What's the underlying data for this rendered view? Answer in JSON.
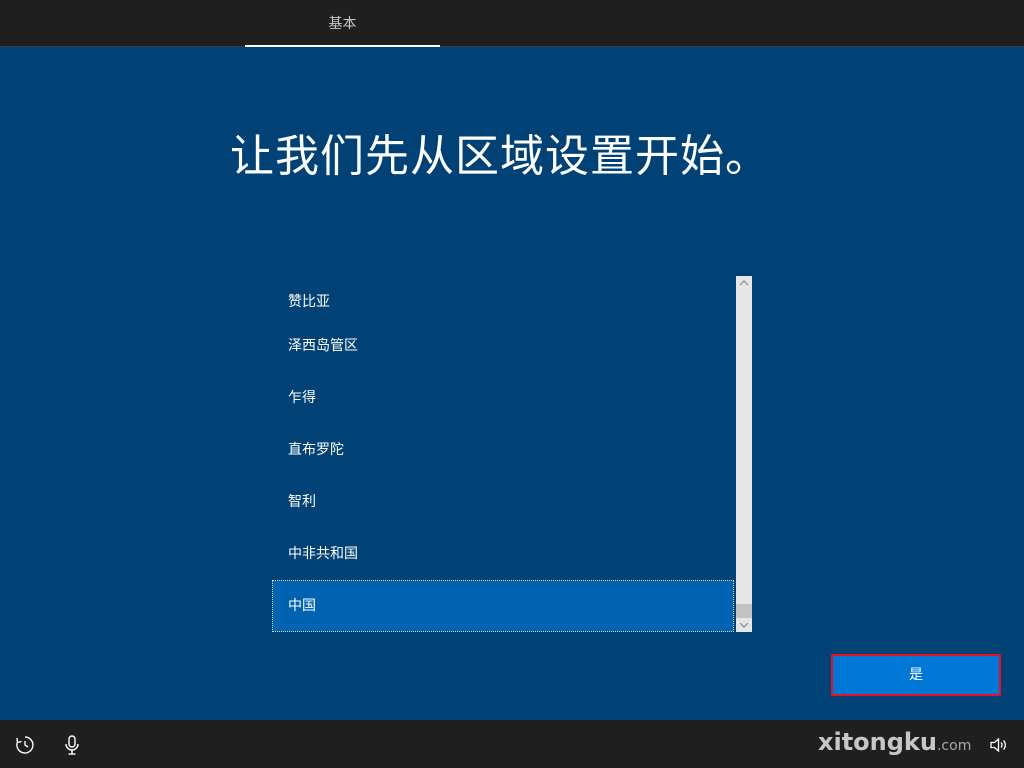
{
  "header": {
    "tabs": [
      {
        "label": "基本",
        "active": true
      }
    ]
  },
  "main": {
    "title": "让我们先从区域设置开始。",
    "region_list": {
      "items": [
        {
          "label": "赞比亚",
          "selected": false
        },
        {
          "label": "泽西岛管区",
          "selected": false
        },
        {
          "label": "乍得",
          "selected": false
        },
        {
          "label": "直布罗陀",
          "selected": false
        },
        {
          "label": "智利",
          "selected": false
        },
        {
          "label": "中非共和国",
          "selected": false
        },
        {
          "label": "中国",
          "selected": true
        }
      ]
    },
    "confirm_button": "是"
  },
  "footer": {
    "icons": [
      "ease-of-access-icon",
      "microphone-icon",
      "volume-icon"
    ],
    "watermark": {
      "brand": "xitongku",
      "suffix": ".com"
    }
  },
  "colors": {
    "background": "#004276",
    "bar": "#1f1f1f",
    "selected_item": "#0063b1",
    "button": "#0078d7",
    "button_border": "#e81123"
  }
}
